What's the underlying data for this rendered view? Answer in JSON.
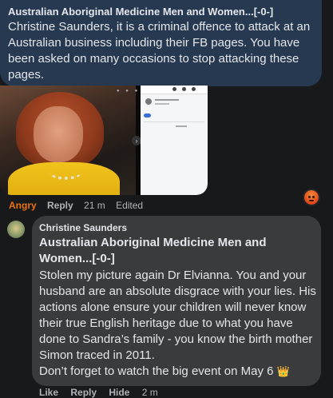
{
  "comment1": {
    "author": "Australian Aboriginal Medicine Men and Women...[-0-]",
    "text": "Christine Saunders, it is a criminal offence to attack at an Australian business including their FB pages. You have been asked on many occasions to stop attacking these pages.",
    "reaction": "Angry",
    "reply_label": "Reply",
    "time": "21 m",
    "edited": "Edited"
  },
  "comment2": {
    "author": "Christine Saunders",
    "tag": "Australian Aboriginal Medicine Men and Women...[-0-]",
    "text": "Stolen my picture again Dr Elvianna. You and your husband are an absolute disgrace with your lies. His actions alone ensure your children will never know their true English heritage due to what you have done to Sandra’s family - you know the birth mother Simon traced in 2011.",
    "last_line": "Don’t forget to watch the big event on May 6",
    "emoji": "👑",
    "like_label": "Like",
    "reply_label": "Reply",
    "hide_label": "Hide",
    "time": "2 m"
  },
  "icons": {
    "angry_reaction": "angry-reaction-icon",
    "crown": "crown-emoji",
    "arrow": "chevron-right-icon"
  },
  "colors": {
    "background": "#18191a",
    "own_bubble": "#263951",
    "reply_bubble": "#3a3b3c",
    "angry": "#e9710f",
    "meta": "#b0b3b8"
  }
}
